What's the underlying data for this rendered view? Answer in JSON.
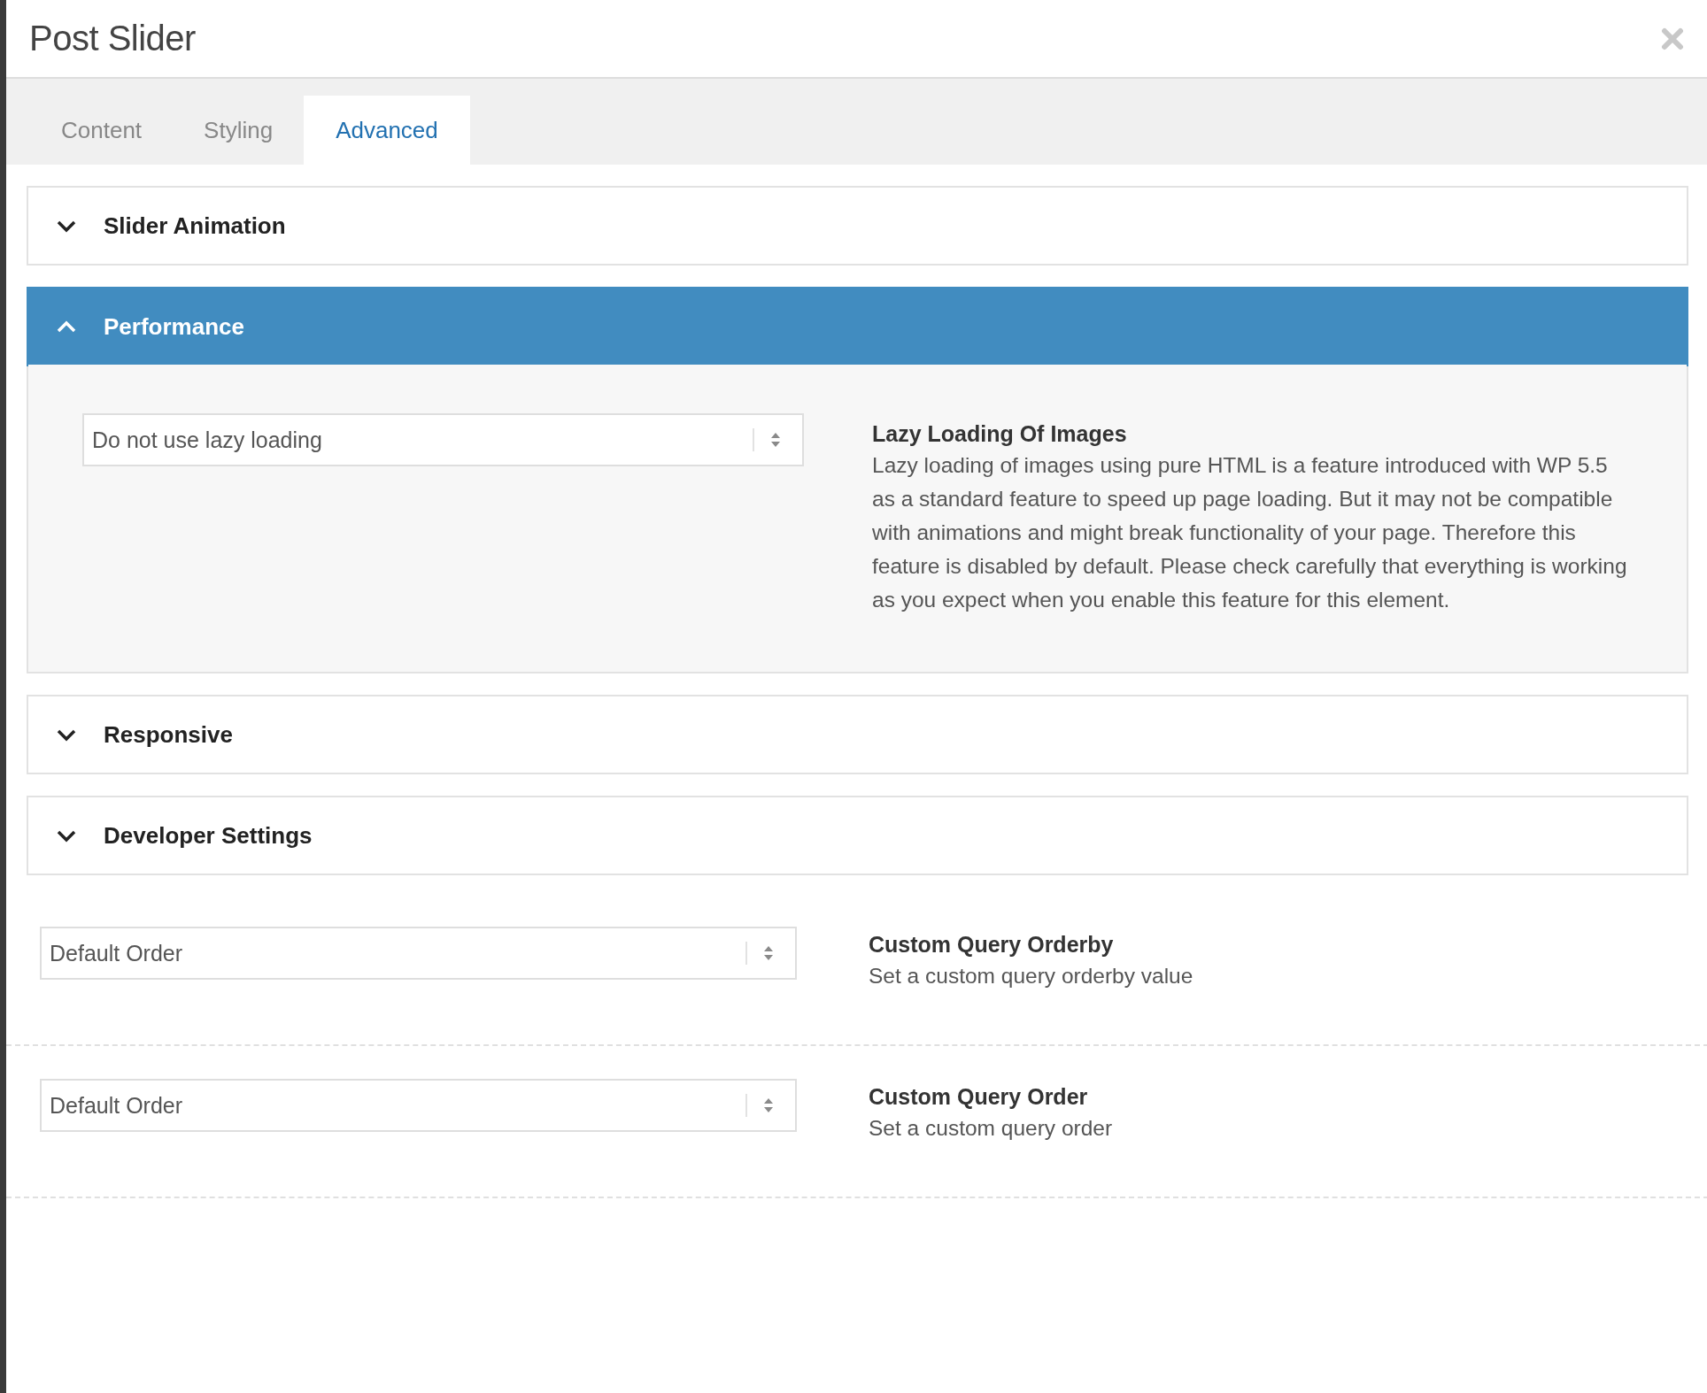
{
  "dialog": {
    "title": "Post Slider"
  },
  "tabs": [
    {
      "label": "Content",
      "selected": false
    },
    {
      "label": "Styling",
      "selected": false
    },
    {
      "label": "Advanced",
      "selected": true
    }
  ],
  "sections": [
    {
      "title": "Slider Animation",
      "expanded": false
    },
    {
      "title": "Performance",
      "expanded": true,
      "fields": [
        {
          "value": "Do not use lazy loading",
          "label": "Lazy Loading Of Images",
          "description": "Lazy loading of images using pure HTML is a feature introduced with WP 5.5 as a standard feature to speed up page loading. But it may not be compatible with animations and might break functionality of your page. Therefore this feature is disabled by default. Please check carefully that everything is working as you expect when you enable this feature for this element."
        }
      ]
    },
    {
      "title": "Responsive",
      "expanded": false
    },
    {
      "title": "Developer Settings",
      "expanded": false
    }
  ],
  "fields": [
    {
      "value": "Default Order",
      "label": "Custom Query Orderby",
      "description": "Set a custom query orderby value"
    },
    {
      "value": "Default Order",
      "label": "Custom Query Order",
      "description": "Set a custom query order"
    }
  ]
}
